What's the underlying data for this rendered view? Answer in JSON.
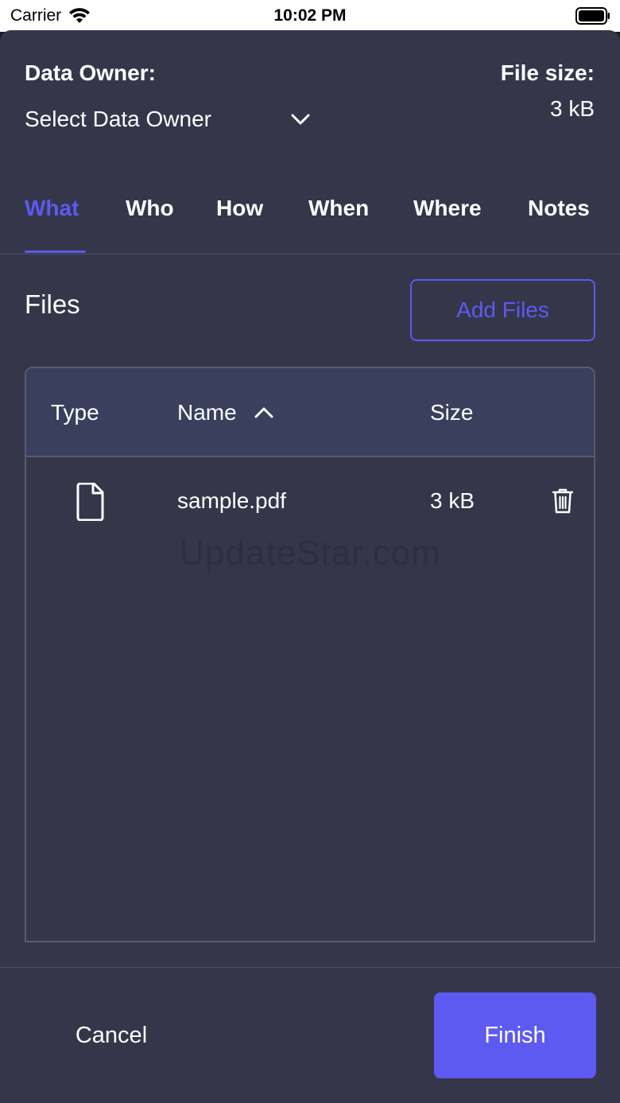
{
  "status_bar": {
    "carrier": "Carrier",
    "time": "10:02 PM",
    "wifi_icon": "wifi-icon",
    "battery_icon": "battery-icon"
  },
  "header": {
    "owner_label": "Data Owner:",
    "owner_value": "Select Data Owner",
    "size_label": "File size:",
    "size_value": "3 kB"
  },
  "tabs": [
    {
      "label": "What",
      "active": true
    },
    {
      "label": "Who",
      "active": false
    },
    {
      "label": "How",
      "active": false
    },
    {
      "label": "When",
      "active": false
    },
    {
      "label": "Where",
      "active": false
    },
    {
      "label": "Notes",
      "active": false
    }
  ],
  "files": {
    "title": "Files",
    "add_label": "Add Files",
    "columns": [
      "Type",
      "Name",
      "Size"
    ],
    "sort": {
      "column": "Name",
      "direction": "ascending"
    },
    "rows": [
      {
        "type_icon": "file-icon",
        "name": "sample.pdf",
        "size": "3 kB",
        "action_icon": "trash-icon"
      }
    ]
  },
  "watermark": "UpdateStar.com",
  "footer": {
    "cancel_label": "Cancel",
    "finish_label": "Finish"
  },
  "colors": {
    "accent": "#5c5af0",
    "background": "#35364a",
    "table_header": "#3a3f5e"
  }
}
